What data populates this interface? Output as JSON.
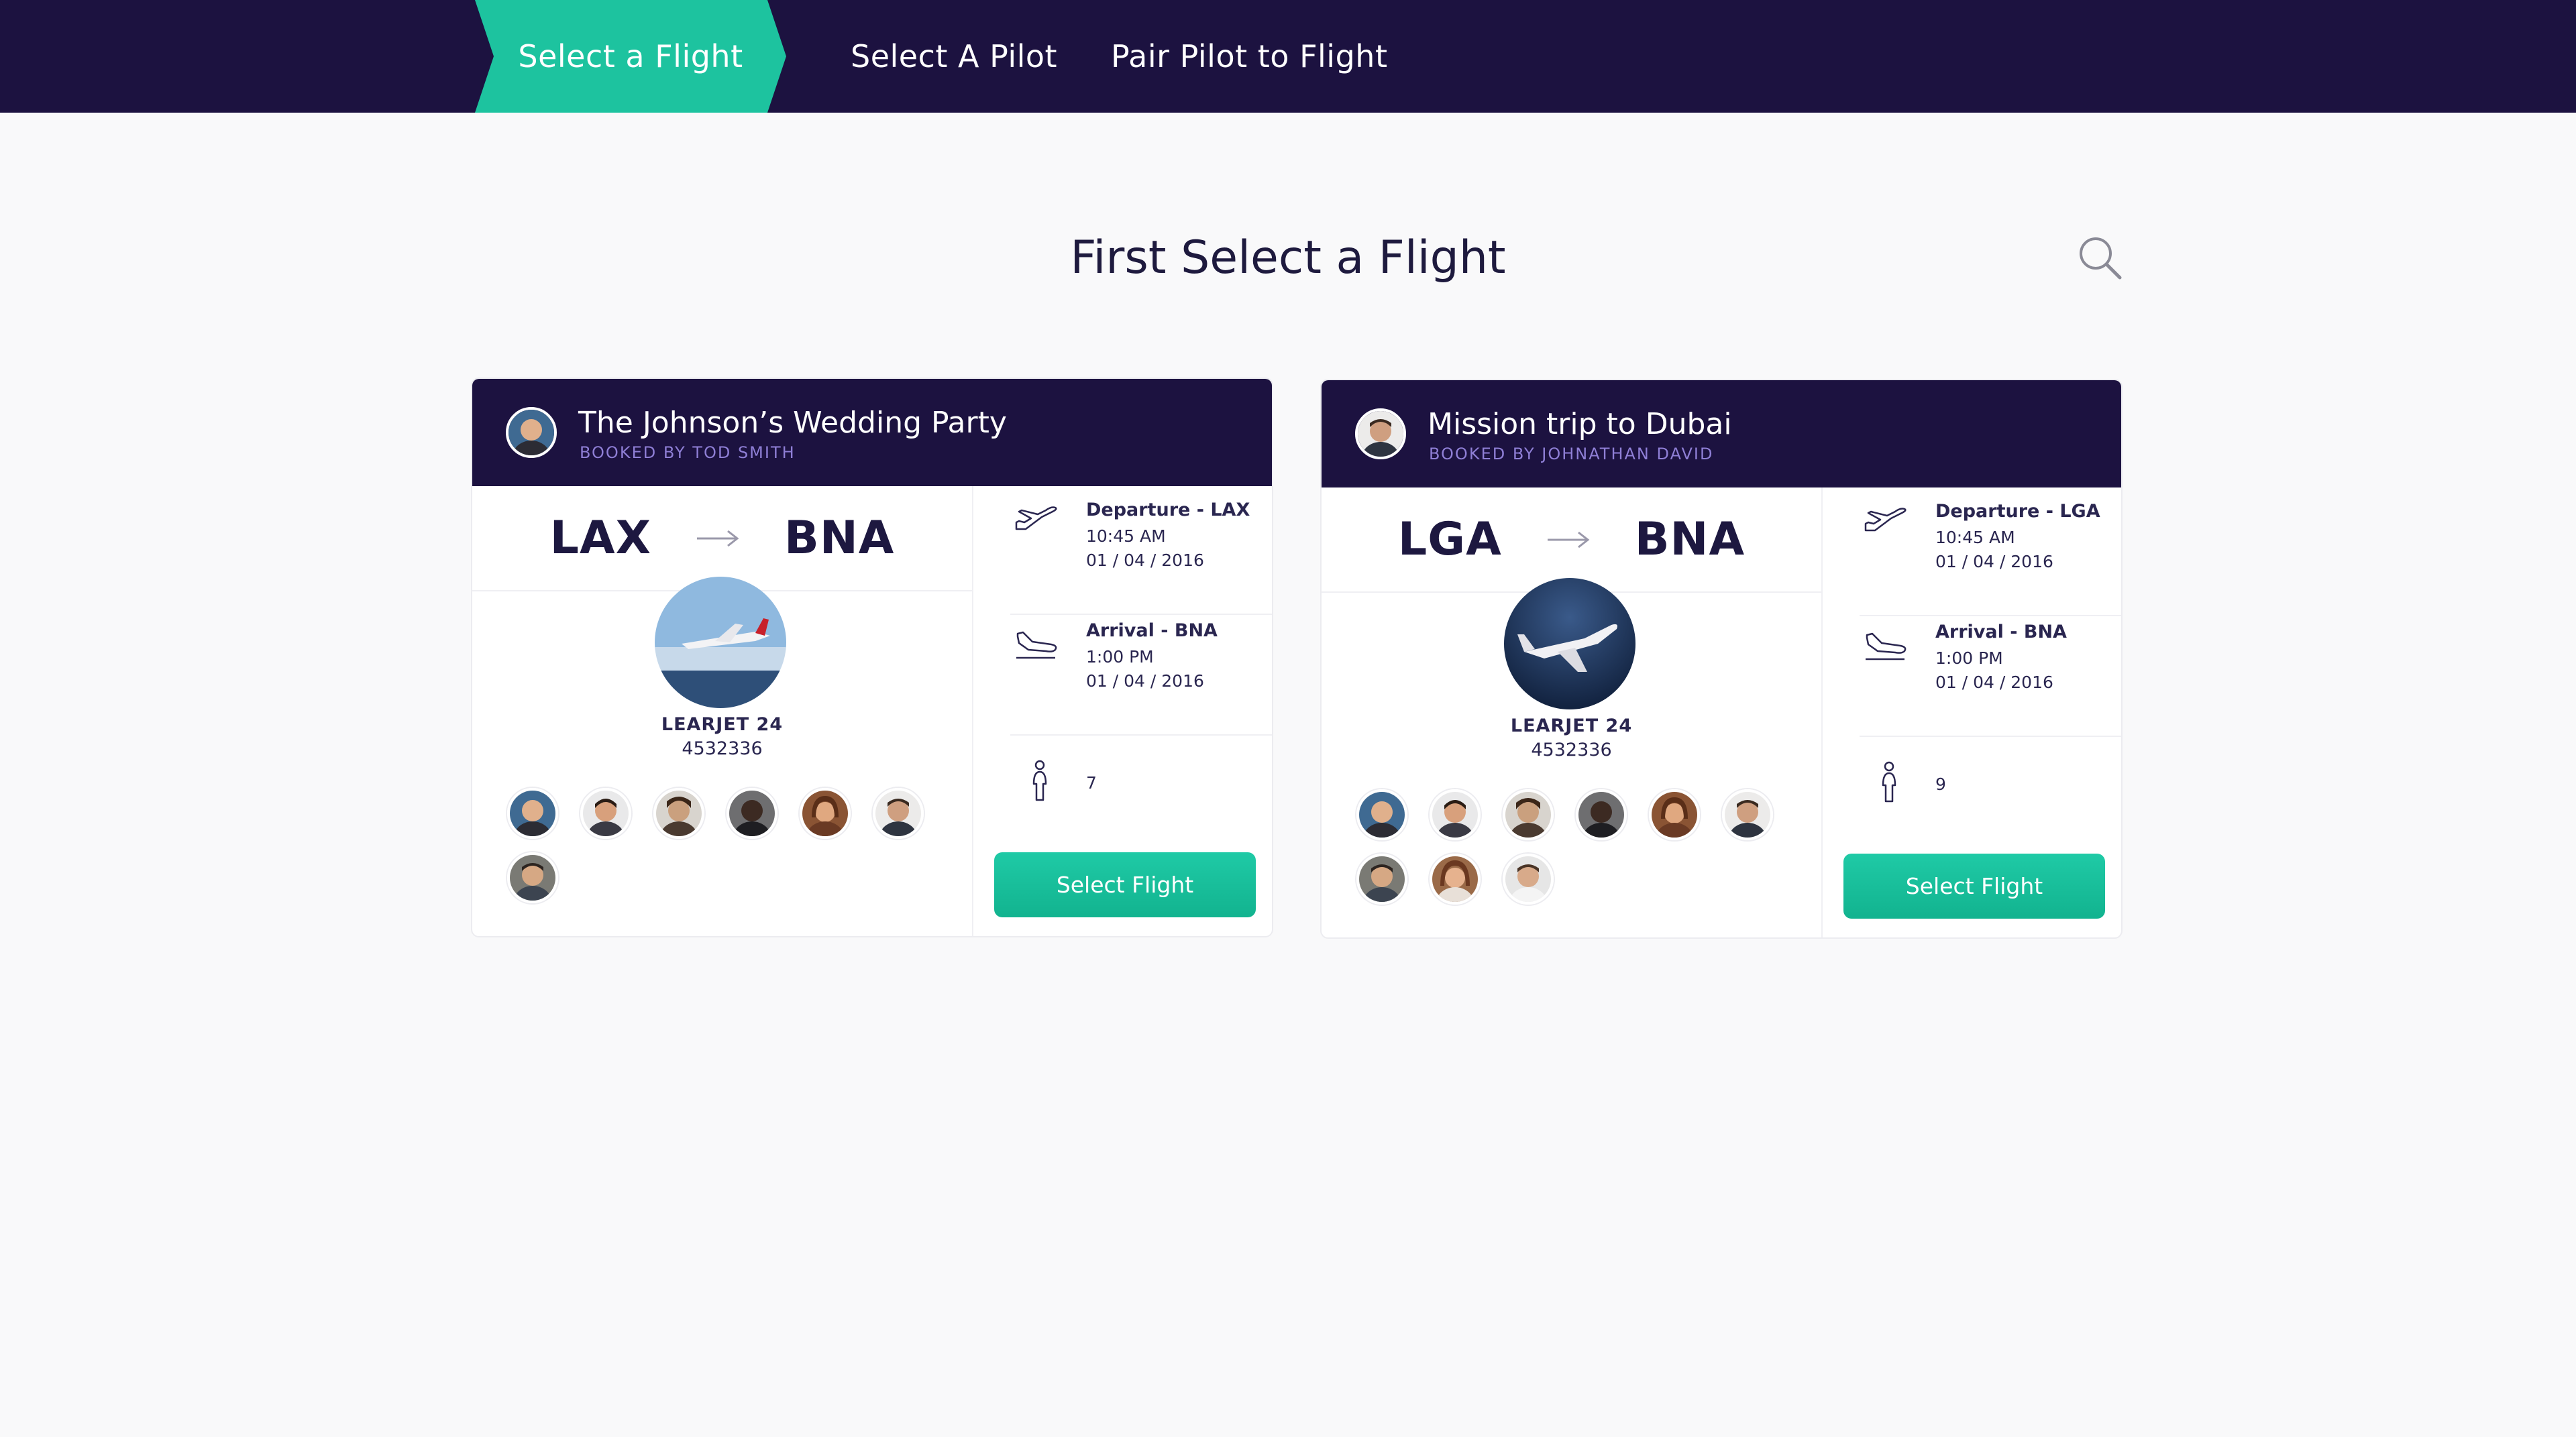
{
  "nav": {
    "steps": [
      {
        "label": "Select a Flight",
        "active": true
      },
      {
        "label": "Select A Pilot",
        "active": false
      },
      {
        "label": "Pair Pilot to Flight",
        "active": false
      }
    ]
  },
  "page": {
    "title": "First Select a Flight",
    "search_icon": "search-icon"
  },
  "colors": {
    "nav_bg": "#1c1240",
    "accent": "#1dc39f",
    "booked_text": "#8f7fd6",
    "page_bg": "#f9f9fa"
  },
  "flights": [
    {
      "title": "The Johnson’s Wedding Party",
      "booked_by": "BOOKED BY TOD SMITH",
      "origin": "LAX",
      "destination": "BNA",
      "aircraft_model": "LEARJET 24",
      "aircraft_tail": "4532336",
      "departure": {
        "label": "Departure - LAX",
        "time": "10:45 AM",
        "date": "01 / 04 / 2016"
      },
      "arrival": {
        "label": "Arrival - BNA",
        "time": "1:00 PM",
        "date": "01 / 04 / 2016"
      },
      "passengers": "7",
      "pilot_count": 7,
      "button_label": "Select Flight"
    },
    {
      "title": "Mission trip to Dubai",
      "booked_by": "BOOKED BY JOHNATHAN DAVID",
      "origin": "LGA",
      "destination": "BNA",
      "aircraft_model": "LEARJET 24",
      "aircraft_tail": "4532336",
      "departure": {
        "label": "Departure - LGA",
        "time": "10:45 AM",
        "date": "01 / 04 / 2016"
      },
      "arrival": {
        "label": "Arrival - BNA",
        "time": "1:00 PM",
        "date": "01 / 04 / 2016"
      },
      "passengers": "9",
      "pilot_count": 9,
      "button_label": "Select Flight"
    }
  ]
}
